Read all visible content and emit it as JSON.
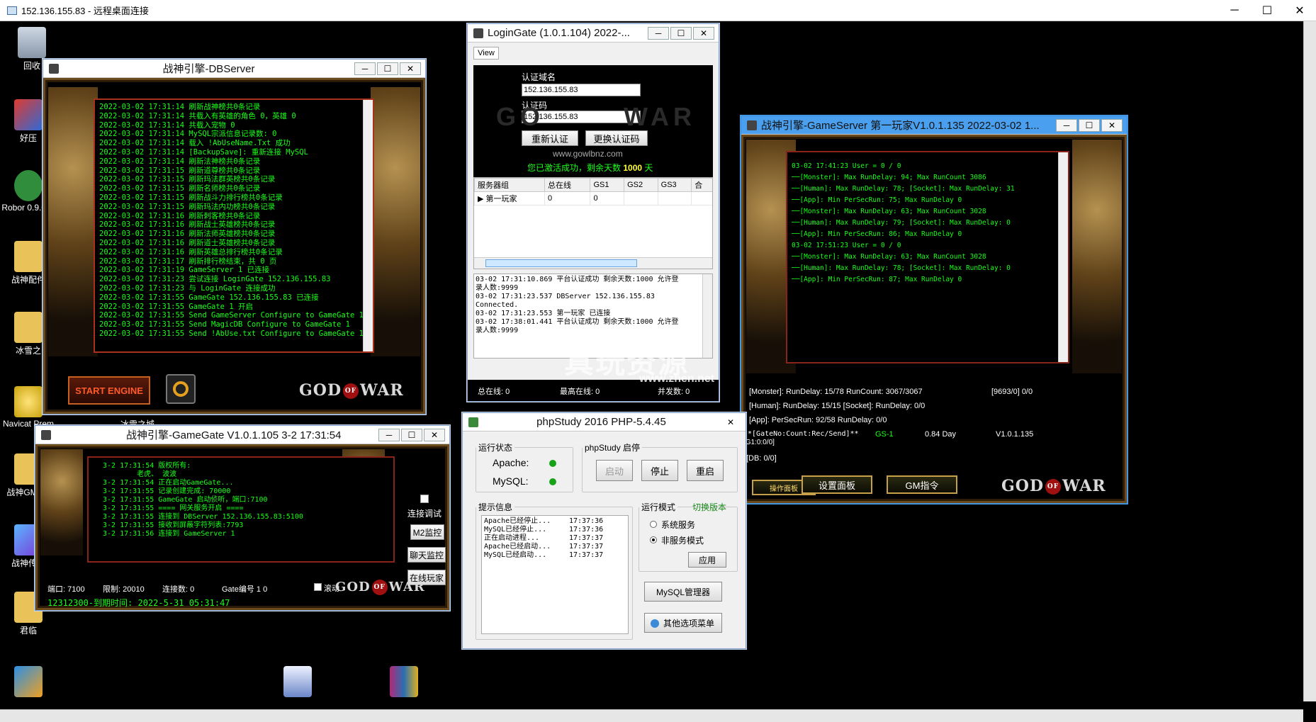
{
  "rdp": {
    "title": "152.136.155.83 - 远程桌面连接",
    "minimize": "─",
    "maximize": "☐",
    "close": "✕"
  },
  "desktop_icons": [
    {
      "label": "回收"
    },
    {
      "label": "好压"
    },
    {
      "label": "Robor 0.9.0-R"
    },
    {
      "label": "战神配件"
    },
    {
      "label": "冰雪之"
    },
    {
      "label": "Navicat Prem"
    },
    {
      "label": "战神GM V1"
    },
    {
      "label": "战神传启"
    },
    {
      "label": "君临"
    },
    {
      "label": "冰雪之城"
    }
  ],
  "db_window": {
    "title": "战神引擎-DBServer",
    "log": [
      "2022-03-02 17:31:14 刷新战神榜共0条记录",
      "2022-03-02 17:31:14 共载入有英雄的角色 0，英雄 0",
      "2022-03-02 17:31:14 共载入宠物 0",
      "2022-03-02 17:31:14 MySQL宗派信息记录数: 0",
      "2022-03-02 17:31:14 载入 !AbUseName.Txt 成功",
      "2022-03-02 17:31:14 [BackupSave]: 重新连接 MySQL",
      "2022-03-02 17:31:14 刷新法神榜共0条记录",
      "2022-03-02 17:31:15 刷新道尊榜共0条记录",
      "2022-03-02 17:31:15 刷新玛法群英榜共0条记录",
      "2022-03-02 17:31:15 刷新名师榜共0条记录",
      "2022-03-02 17:31:15 刷新战斗力排行榜共0条记录",
      "2022-03-02 17:31:15 刷新玛法内功榜共0条记录",
      "2022-03-02 17:31:16 刷新刺客榜共0条记录",
      "2022-03-02 17:31:16 刷新战士英雄榜共0条记录",
      "2022-03-02 17:31:16 刷新法师英雄榜共0条记录",
      "2022-03-02 17:31:16 刷新道士英雄榜共0条记录",
      "2022-03-02 17:31:16 刷新英雄总排行榜共0条记录",
      "2022-03-02 17:31:17 刷新排行榜结束，共 0 页",
      "2022-03-02 17:31:19 GameServer 1 已连接",
      "2022-03-02 17:31:23 尝试连接 LoginGate 152.136.155.83",
      "2022-03-02 17:31:23 与 LoginGate 连接成功",
      "2022-03-02 17:31:55 GameGate 152.136.155.83 已连接",
      "2022-03-02 17:31:55 GameGate 1 开启",
      "2022-03-02 17:31:55 Send GameServer Configure to GameGate 1",
      "2022-03-02 17:31:55 Send MagicDB Configure to GameGate 1",
      "2022-03-02 17:31:55 Send !AbUse.txt Configure to GameGate 1"
    ],
    "start_label": "START ENGINE",
    "logo_left": "GOD",
    "logo_of": "OF",
    "logo_right": "WAR"
  },
  "gamegate_window": {
    "title": "战神引擎-GameGate V1.0.1.105 3-2 17:31:54",
    "log": [
      "3-2 17:31:54 版权所有:",
      "        老虎、 波波",
      "3-2 17:31:54 正在启动GameGate...",
      "3-2 17:31:55 记录创建完成: 70000",
      "3-2 17:31:55 GameGate 启动侦听，端口:7100",
      "3-2 17:31:55 ==== 网关服务开启 ====",
      "3-2 17:31:55 连接到 DBServer 152.136.155.83:5100",
      "3-2 17:31:55 接收到屏蔽字符列表:7793",
      "3-2 17:31:56 连接到 GameServer 1"
    ],
    "debug_label": "连接调试",
    "m2_label": "M2监控",
    "chat_label": "聊天监控",
    "online_label": "在线玩家",
    "status_port": "端口: 7100",
    "status_limit": "限制: 20010",
    "status_conn": "连接数: 0",
    "status_gate": "Gate编号 1 0",
    "scroll_label": "滚动",
    "license": "12312300-到期时间: 2022-5-31 05:31:47"
  },
  "logingate_window": {
    "title": "LoginGate (1.0.1.104)  2022-...",
    "view_menu": "View",
    "auth_domain_label": "认证域名",
    "auth_domain_value": "152.136.155.83",
    "auth_code_label": "认证码",
    "auth_code_value": "152.136.155.83",
    "reauth_btn": "重新认证",
    "change_code_btn": "更换认证码",
    "website": "www.gowlbnz.com",
    "activation_prefix": "您已激活成功，剩余天数",
    "activation_days": "1000",
    "activation_suffix": "天",
    "columns": [
      "服务器组",
      "总在线",
      "GS1",
      "GS2",
      "GS3",
      "合"
    ],
    "rows": [
      [
        "第一玩家",
        "0",
        "0",
        "",
        "",
        ""
      ]
    ],
    "log": [
      "03-02 17:31:10.869 平台认证成功 剩余天数:1000 允许登",
      "录人数:9999",
      "03-02 17:31:23.537 DBServer 152.136.155.83",
      "Connected.",
      "03-02 17:31:23.553 第一玩家 已连接",
      "03-02 17:38:01.441 平台认证成功 剩余天数:1000 允许登",
      "录人数:9999"
    ],
    "total_online": "总在线: 0",
    "max_online": "最高在线: 0",
    "concurrent": "并发数: 0"
  },
  "gameserver_window": {
    "title": "战神引擎-GameServer 第一玩家V1.0.1.135 2022-03-02 1...",
    "log": [
      "03-02 17:41:23 User = 0 / 0",
      "",
      "──[Monster]: Max RunDelay: 94; Max RunCount 3086",
      "──[Human]: Max RunDelay: 78; [Socket]: Max RunDelay: 31",
      "──[App]: Min PerSecRun: 75; Max RunDelay 0",
      "",
      "",
      "──[Monster]: Max RunDelay: 63; Max RunCount 3028",
      "──[Human]: Max RunDelay: 79; [Socket]: Max RunDelay: 0",
      "──[App]: Min PerSecRun: 86; Max RunDelay 0",
      "",
      "03-02 17:51:23 User = 0 / 0",
      "",
      "──[Monster]: Max RunDelay: 63; Max RunCount 3028",
      "──[Human]: Max RunDelay: 78; [Socket]: Max RunDelay: 0",
      "──[App]: Min PerSecRun: 87; Max RunDelay 0"
    ],
    "stat1": "[Monster]: RunDelay: 15/78 RunCount: 3067/3067",
    "stat1b": "[9693/0] 0/0",
    "stat2": "[Human]: RunDelay: 15/15 [Socket]: RunDelay: 0/0",
    "stat3": "[App]: PerSecRun: 92/58 RunDelay: 0/0",
    "gate_header": "**[GateNo:Count:Rec/Send]**",
    "gate_gs": "GS-1",
    "gate_day": "0.84 Day",
    "gate_ver": "V1.0.1.135",
    "gate_g1": "[G1:0:0/0]",
    "db_stat": "[DB: 0/0]",
    "btn_ops": "操作面板",
    "btn_settings": "设置面板",
    "btn_gm": "GM指令"
  },
  "phpstudy_window": {
    "title": "phpStudy 2016   PHP-5.4.45",
    "run_status": "运行状态",
    "apache_label": "Apache:",
    "mysql_label": "MySQL:",
    "control_label": "phpStudy 启停",
    "start_btn": "启动",
    "stop_btn": "停止",
    "restart_btn": "重启",
    "tips_label": "提示信息",
    "tips": [
      [
        "Apache已经停止...",
        "17:37:36"
      ],
      [
        "MySQL已经停止...",
        "17:37:36"
      ],
      [
        "正在启动进程...",
        "17:37:37"
      ],
      [
        "Apache已经启动...",
        "17:37:37"
      ],
      [
        "MySQL已经启动...",
        "17:37:37"
      ]
    ],
    "mode_label": "运行模式",
    "switch_version": "切换版本",
    "system_service": "系统服务",
    "non_service": "非服务模式",
    "apply_btn": "应用",
    "mysql_manager": "MySQL管理器",
    "other_menu": "其他选项菜单"
  },
  "watermark": {
    "text": "真玩资源",
    "url": "www.zhen.net"
  },
  "colors": {
    "log_green": "#19ff19",
    "frame_gold": "#c7a04a",
    "status_green": "#17a317"
  }
}
